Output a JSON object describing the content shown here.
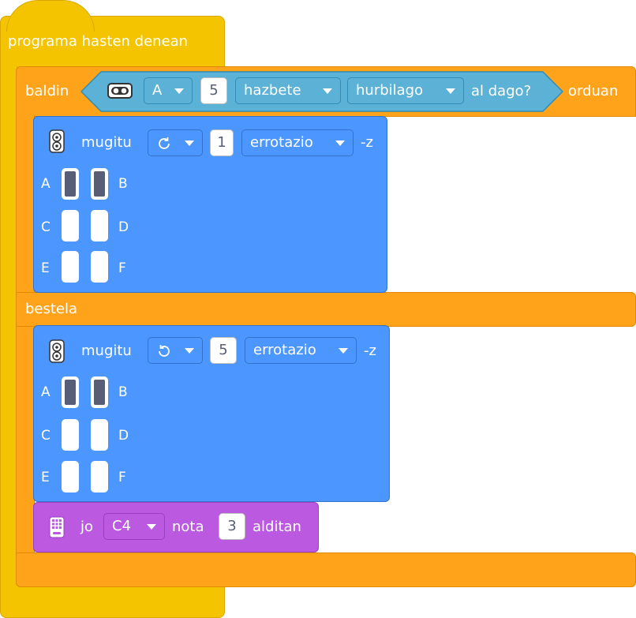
{
  "hat": {
    "label": "programa hasten denean"
  },
  "if_block": {
    "if_label": "baldin",
    "then_label": "orduan",
    "else_label": "bestela",
    "condition": {
      "port": "A",
      "value": "5",
      "unit": "hazbete",
      "comparison": "hurbilago",
      "suffix": "al dago?"
    }
  },
  "move_blocks": [
    {
      "label": "mugitu",
      "direction_icon": "clockwise-icon",
      "amount": "1",
      "unit": "errotazio",
      "suffix": "-z",
      "ports": {
        "A": {
          "label": "A",
          "on": true
        },
        "B": {
          "label": "B",
          "on": true
        },
        "C": {
          "label": "C",
          "on": false
        },
        "D": {
          "label": "D",
          "on": false
        },
        "E": {
          "label": "E",
          "on": false
        },
        "F": {
          "label": "F",
          "on": false
        }
      }
    },
    {
      "label": "mugitu",
      "direction_icon": "counterclockwise-icon",
      "amount": "5",
      "unit": "errotazio",
      "suffix": "-z",
      "ports": {
        "A": {
          "label": "A",
          "on": true
        },
        "B": {
          "label": "B",
          "on": true
        },
        "C": {
          "label": "C",
          "on": false
        },
        "D": {
          "label": "D",
          "on": false
        },
        "E": {
          "label": "E",
          "on": false
        },
        "F": {
          "label": "F",
          "on": false
        }
      }
    }
  ],
  "play_block": {
    "label": "jo",
    "note": "C4",
    "note_label": "nota",
    "times": "3",
    "times_label": "alditan"
  },
  "colors": {
    "hat": "#f5c400",
    "control": "#ffa31a",
    "motion": "#4c97ff",
    "sensor": "#5cb1d6",
    "sound": "#bb59e0"
  }
}
